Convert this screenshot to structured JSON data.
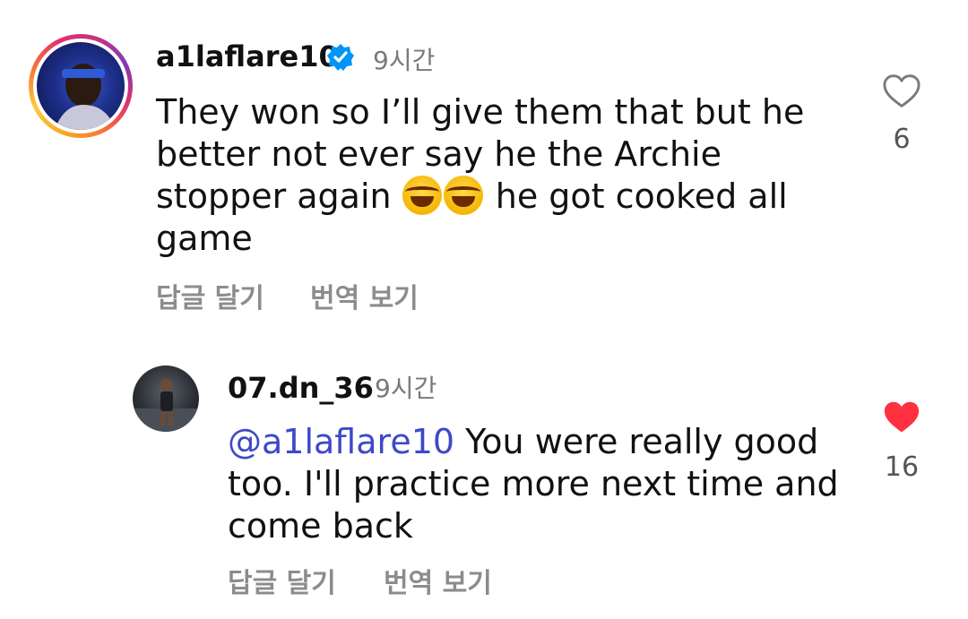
{
  "comments": [
    {
      "username": "a1laflare10",
      "verified": true,
      "time": "9시간",
      "text_before_emoji": "They won so I’ll give them that but he better not ever say he the Archie stopper again ",
      "emojis": [
        "face-with-tears-of-joy",
        "face-with-tears-of-joy"
      ],
      "text_after_emoji": " he got cooked all game",
      "reply_label": "답글 달기",
      "translate_label": "번역 보기",
      "like_count": "6",
      "liked": false
    },
    {
      "username": "07.dn_36",
      "verified": false,
      "time": "9시간",
      "mention": "@a1laflare10",
      "text": " You were really good too. I'll practice more next time and come back",
      "reply_label": "답글 달기",
      "translate_label": "번역 보기",
      "like_count": "16",
      "liked": true
    }
  ],
  "colors": {
    "mention": "#3d49c7",
    "verified_badge": "#0095f6",
    "liked_heart": "#ff3040",
    "secondary_text": "#8c8c8c"
  }
}
